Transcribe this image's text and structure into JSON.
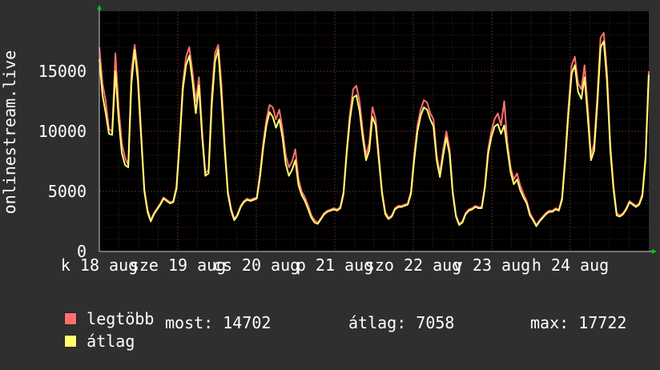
{
  "chart_data": {
    "type": "area",
    "ylabel": "onlinestream.live",
    "ylim": [
      0,
      20000
    ],
    "yticks": [
      0,
      5000,
      10000,
      15000
    ],
    "grid": true,
    "xtick_labels": [
      "k 18 aug",
      "sze 19 aug",
      "cs 20 aug",
      "p 21 aug",
      "szo 22 aug",
      "v 23 aug",
      "h 24 aug"
    ],
    "x_days": 7,
    "series": [
      {
        "name": "legtöbb",
        "color": "#ff7070",
        "values": [
          17000,
          14000,
          12500,
          10200,
          10000,
          16500,
          12000,
          9000,
          7800,
          7200,
          15000,
          17200,
          15000,
          10000,
          5200,
          3500,
          2600,
          3200,
          3600,
          4000,
          4500,
          4300,
          4100,
          4200,
          5400,
          9500,
          14000,
          16200,
          17000,
          15000,
          12500,
          14500,
          10000,
          6500,
          6800,
          13000,
          16500,
          17200,
          14000,
          9000,
          5000,
          3600,
          2700,
          3100,
          3800,
          4200,
          4400,
          4300,
          4400,
          4500,
          6500,
          9000,
          11000,
          12200,
          12000,
          11000,
          11800,
          10200,
          8000,
          7000,
          7500,
          8500,
          6000,
          5000,
          4500,
          3800,
          3000,
          2600,
          2400,
          2800,
          3200,
          3400,
          3500,
          3600,
          3500,
          3700,
          5000,
          8500,
          11500,
          13500,
          13800,
          12500,
          10000,
          8000,
          9000,
          12000,
          11000,
          8000,
          5000,
          3300,
          2800,
          3000,
          3600,
          3800,
          3800,
          3900,
          4000,
          5000,
          8000,
          10500,
          11800,
          12600,
          12400,
          11500,
          11000,
          8000,
          6500,
          8500,
          10000,
          8500,
          5000,
          3000,
          2300,
          2500,
          3200,
          3500,
          3600,
          3800,
          3700,
          3700,
          5500,
          8500,
          10000,
          11000,
          11500,
          10500,
          12500,
          9000,
          7000,
          6000,
          6500,
          5500,
          4800,
          4200,
          3200,
          2700,
          2200,
          2600,
          2900,
          3200,
          3400,
          3400,
          3600,
          3500,
          4500,
          8000,
          12000,
          15500,
          16200,
          14000,
          13500,
          15500,
          12000,
          8000,
          9000,
          13000,
          17800,
          18200,
          15000,
          9000,
          5500,
          3200,
          3000,
          3200,
          3600,
          4200,
          4000,
          3800,
          4000,
          4800,
          8000,
          15000
        ]
      },
      {
        "name": "átlag",
        "color": "#ffff70",
        "values": [
          16000,
          13000,
          11500,
          9800,
          9700,
          15000,
          11000,
          8200,
          7200,
          7000,
          14000,
          16800,
          14200,
          9500,
          5000,
          3300,
          2500,
          3100,
          3500,
          3900,
          4400,
          4200,
          4000,
          4100,
          5200,
          9000,
          13500,
          15500,
          16300,
          14200,
          11500,
          13800,
          9500,
          6300,
          6500,
          12200,
          15800,
          16800,
          13000,
          8500,
          4800,
          3400,
          2600,
          3000,
          3700,
          4100,
          4300,
          4200,
          4300,
          4400,
          6200,
          8600,
          10500,
          11600,
          11200,
          10300,
          11000,
          9500,
          7300,
          6300,
          6800,
          7600,
          5500,
          4700,
          4200,
          3500,
          2800,
          2400,
          2300,
          2700,
          3100,
          3300,
          3400,
          3500,
          3400,
          3600,
          4800,
          8200,
          11000,
          12800,
          13000,
          11700,
          9400,
          7600,
          8400,
          11200,
          10500,
          7600,
          4800,
          3100,
          2700,
          2900,
          3500,
          3700,
          3700,
          3800,
          3900,
          4800,
          7600,
          10000,
          11300,
          12000,
          11800,
          11000,
          10400,
          7600,
          6200,
          8000,
          9500,
          8100,
          4800,
          2900,
          2200,
          2400,
          3100,
          3400,
          3500,
          3700,
          3600,
          3600,
          5300,
          8100,
          9500,
          10400,
          10600,
          9800,
          10500,
          8500,
          6600,
          5600,
          6000,
          5100,
          4500,
          4000,
          3000,
          2600,
          2100,
          2500,
          2800,
          3100,
          3300,
          3300,
          3500,
          3400,
          4300,
          7600,
          11500,
          14800,
          15500,
          13300,
          12700,
          14500,
          11200,
          7600,
          8400,
          12300,
          17000,
          17500,
          14200,
          8500,
          5200,
          3000,
          2900,
          3100,
          3500,
          4100,
          3900,
          3700,
          3900,
          4600,
          7700,
          14702
        ]
      }
    ]
  },
  "legend": {
    "items": [
      {
        "label": "legtöbb",
        "color": "#ff7070"
      },
      {
        "label": "átlag",
        "color": "#ffff70"
      }
    ],
    "stats": {
      "most_label": "most:",
      "most_value": "14702",
      "atlag_label": "átlag:",
      "atlag_value": "7058",
      "max_label": "max:",
      "max_value": "17722"
    }
  },
  "colors": {
    "background": "#2f2f2f",
    "plot_background": "#000000",
    "grid_minor": "#3a2020",
    "grid_major": "#5a2a2a",
    "axis_arrow": "#00cc00"
  }
}
